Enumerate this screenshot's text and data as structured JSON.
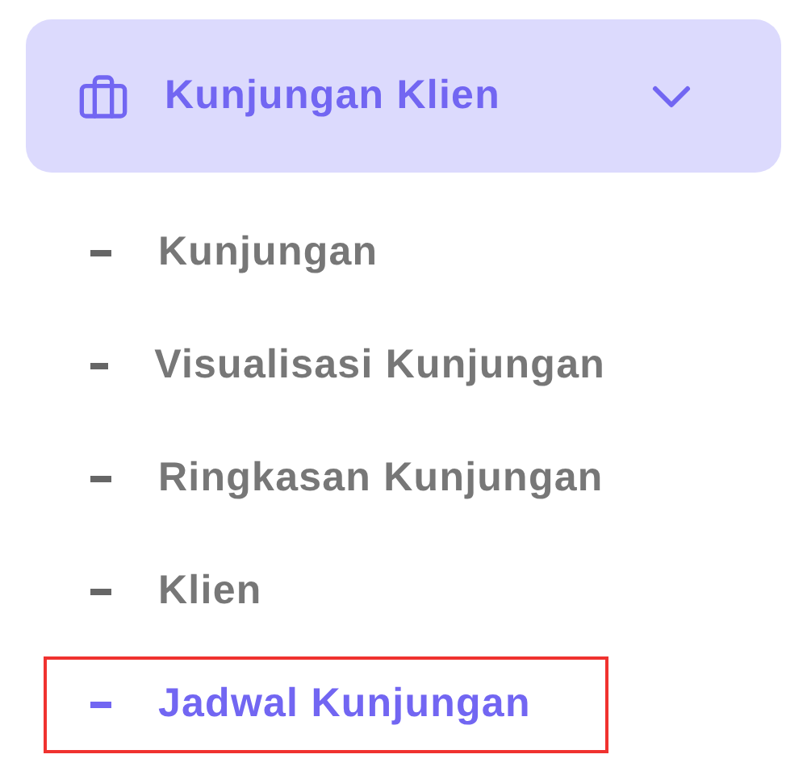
{
  "menu": {
    "title": "Kunjungan Klien",
    "expanded": true,
    "items": [
      {
        "label": "Kunjungan",
        "selected": false
      },
      {
        "label": "Visualisasi Kunjungan",
        "selected": false
      },
      {
        "label": "Ringkasan Kunjungan",
        "selected": false
      },
      {
        "label": "Klien",
        "selected": false
      },
      {
        "label": "Jadwal Kunjungan",
        "selected": true
      }
    ]
  }
}
